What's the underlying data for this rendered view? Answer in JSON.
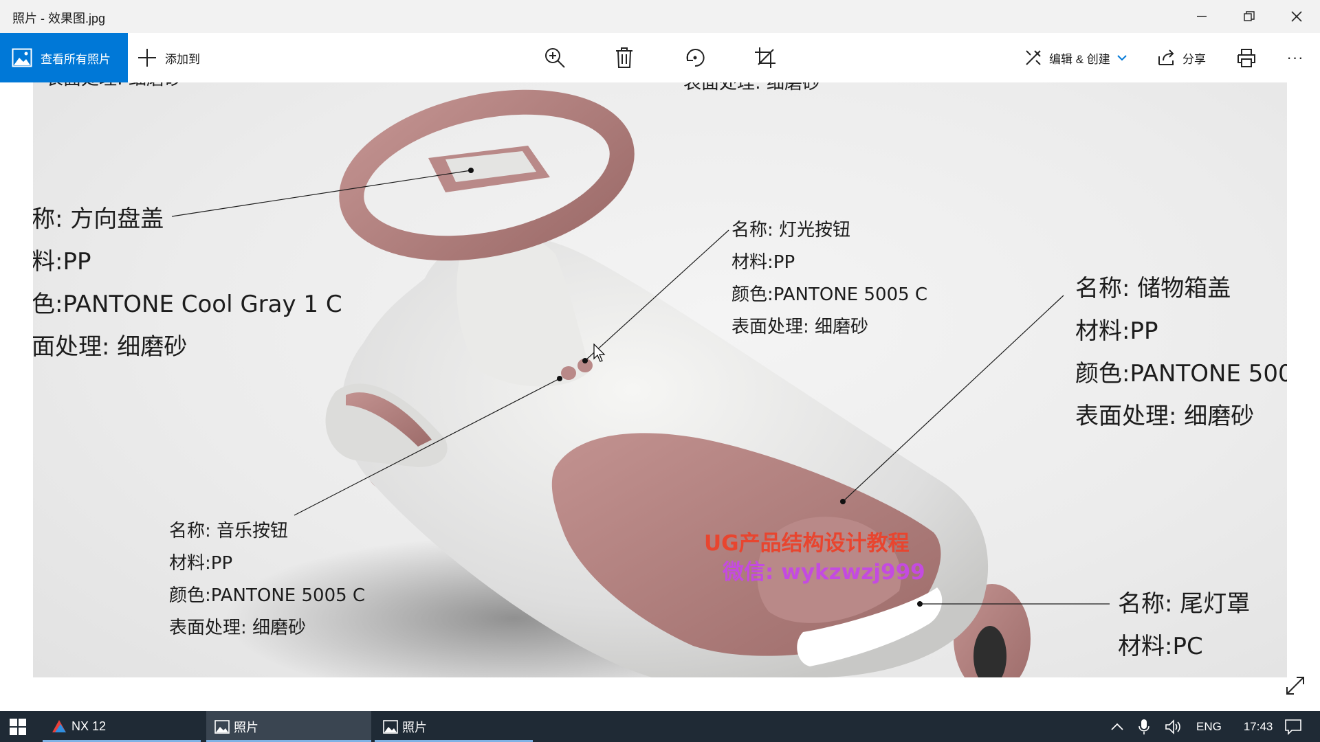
{
  "window": {
    "title": "照片 - 效果图.jpg",
    "controls": {
      "minimize": "—",
      "restore": "❐",
      "close": "✕"
    }
  },
  "toolbar": {
    "view_all_label": "查看所有照片",
    "add_to_label": "添加到",
    "icons": [
      "zoom-in-icon",
      "delete-icon",
      "rotate-icon",
      "crop-icon"
    ],
    "edit_create_label": "编辑 & 创建",
    "share_label": "分享",
    "more_label": "···",
    "accent_color": "#0078d7"
  },
  "photo": {
    "labels": {
      "top_left_partial": "表面处理: 细磨砂",
      "top_center_partial": "表面处理: 细磨砂",
      "steering": [
        "称: 方向盘盖",
        "料:PP",
        "色:PANTONE Cool Gray 1 C",
        "面处理: 细磨砂"
      ],
      "light_button": [
        "名称: 灯光按钮",
        "材料:PP",
        "颜色:PANTONE 5005 C",
        "表面处理: 细磨砂"
      ],
      "storage_lid": [
        "名称: 储物箱盖",
        "材料:PP",
        "颜色:PANTONE 500",
        "表面处理: 细磨砂"
      ],
      "music_button": [
        "名称: 音乐按钮",
        "材料:PP",
        "颜色:PANTONE 5005 C",
        "表面处理: 细磨砂"
      ],
      "tail_light": [
        "名称: 尾灯罩",
        "材料:PC"
      ]
    },
    "watermark": {
      "line1": "UG产品结构设计教程",
      "line2": "微信: wykzwzj999",
      "color1": "#e8452f",
      "color2": "#c44be0"
    },
    "product_colors": {
      "body": "#e7e7e4",
      "accent": "#b07e7c"
    }
  },
  "taskbar": {
    "start_icon": "windows-logo-icon",
    "tasks": [
      {
        "label": "NX 12",
        "icon": "nx-icon"
      },
      {
        "label": "照片",
        "icon": "photos-icon"
      },
      {
        "label": "照片",
        "icon": "photos-icon"
      }
    ],
    "tray": {
      "language": "ENG",
      "time": "17:43"
    },
    "background": "#1f2a35"
  }
}
